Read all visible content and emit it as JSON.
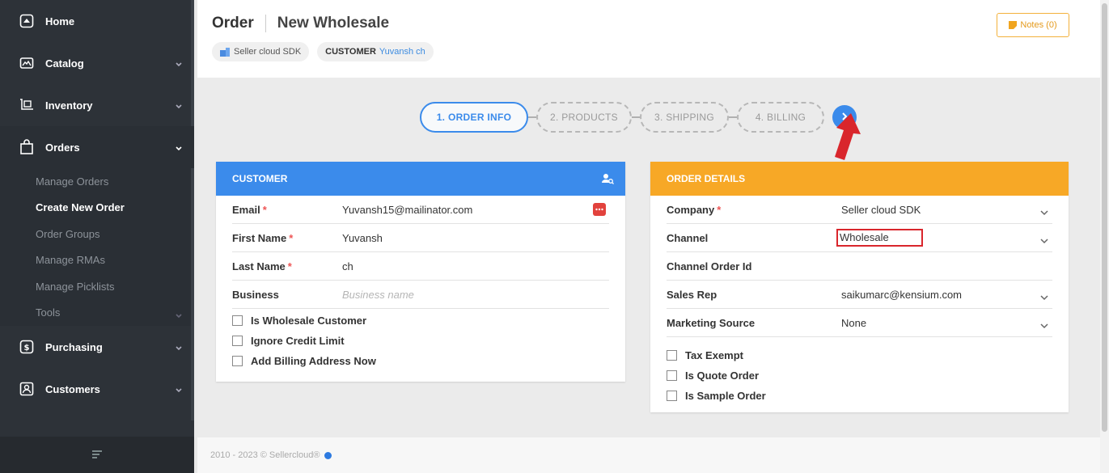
{
  "sidebar": {
    "items": [
      {
        "label": "Home",
        "icon": "home-icon"
      },
      {
        "label": "Catalog",
        "icon": "catalog-icon"
      },
      {
        "label": "Inventory",
        "icon": "inventory-icon"
      },
      {
        "label": "Orders",
        "icon": "shopping-bag-icon"
      }
    ],
    "orders_sub": [
      "Manage Orders",
      "Create New Order",
      "Order Groups",
      "Manage RMAs",
      "Manage Picklists",
      "Tools"
    ],
    "bottom_items": [
      {
        "label": "Purchasing",
        "icon": "dollar-icon"
      },
      {
        "label": "Customers",
        "icon": "customers-icon"
      }
    ]
  },
  "header": {
    "title": "Order",
    "subtitle": "New Wholesale",
    "company_chip": "Seller cloud SDK",
    "customer_key": "CUSTOMER",
    "customer_value": "Yuvansh ch",
    "notes_label": "Notes (0)"
  },
  "stepper": {
    "steps": [
      "1. ORDER INFO",
      "2. PRODUCTS",
      "3. SHIPPING",
      "4. BILLING"
    ],
    "next_icon": "chevron-right-icon"
  },
  "customer_card": {
    "title": "CUSTOMER",
    "fields": [
      {
        "label": "Email",
        "required": "*",
        "value": "Yuvansh15@mailinator.com"
      },
      {
        "label": "First Name",
        "required": "*",
        "value": "Yuvansh"
      },
      {
        "label": "Last Name",
        "required": "*",
        "value": "ch"
      },
      {
        "label": "Business",
        "placeholder": "Business name"
      }
    ],
    "checkboxes": [
      "Is Wholesale Customer",
      "Ignore Credit Limit",
      "Add Billing Address Now"
    ]
  },
  "order_card": {
    "title": "ORDER DETAILS",
    "fields": [
      {
        "label": "Company",
        "required": "*",
        "value": "Seller cloud SDK"
      },
      {
        "label": "Channel",
        "value": "Wholesale"
      },
      {
        "label": "Channel Order Id",
        "value": ""
      },
      {
        "label": "Sales Rep",
        "value": "saikumarc@kensium.com"
      },
      {
        "label": "Marketing Source",
        "value": "None"
      }
    ],
    "checkboxes": [
      "Tax Exempt",
      "Is Quote Order",
      "Is Sample Order"
    ]
  },
  "footer": {
    "text": "2010 - 2023 © Sellercloud®"
  },
  "colors": {
    "primary": "#3b8beb",
    "orange": "#f7a826",
    "sidebar": "#2d3238",
    "highlight_red": "#d9262c"
  }
}
